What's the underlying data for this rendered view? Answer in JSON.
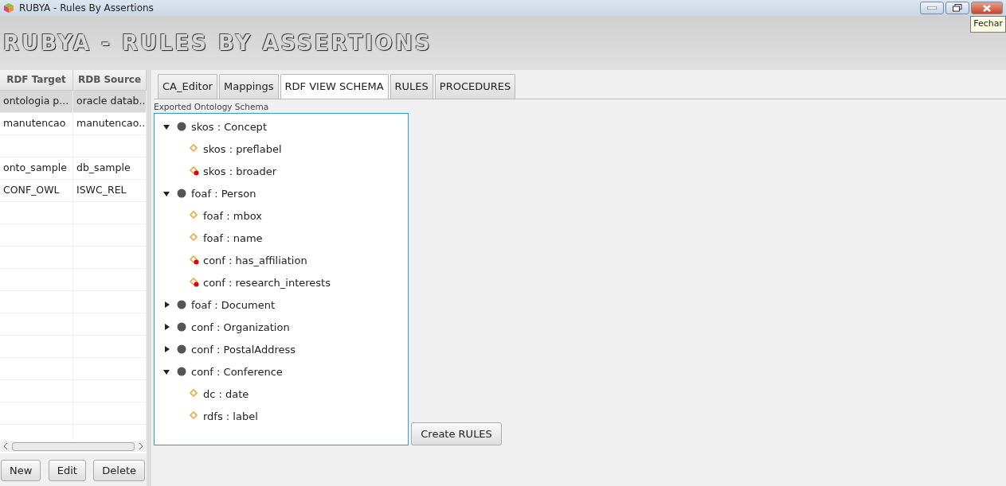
{
  "window": {
    "title": "RUBYA - Rules By Assertions",
    "tooltip": "Fechar"
  },
  "banner": {
    "title": "RUBYA - RULES BY ASSERTIONS"
  },
  "table": {
    "columns": [
      "RDF Target",
      "RDB Source"
    ],
    "rows": [
      {
        "kind": "data",
        "cells": [
          "ontologia p...",
          "oracle datab..."
        ],
        "selected": true
      },
      {
        "kind": "data",
        "cells": [
          "manutencao",
          "manutencao..."
        ],
        "selected": false
      },
      {
        "kind": "blank",
        "selected": false
      },
      {
        "kind": "data",
        "cells": [
          "onto_sample",
          "db_sample"
        ],
        "selected": false
      },
      {
        "kind": "data",
        "cells": [
          "CONF_OWL",
          "ISWC_REL"
        ],
        "selected": false
      }
    ]
  },
  "buttons": [
    "New",
    "Edit",
    "Delete"
  ],
  "tabs": [
    {
      "label": "CA_Editor",
      "selected": false
    },
    {
      "label": "Mappings",
      "selected": false
    },
    {
      "label": "RDF VIEW SCHEMA",
      "selected": true
    },
    {
      "label": "RULES",
      "selected": false
    },
    {
      "label": "PROCEDURES",
      "selected": false
    }
  ],
  "tree": {
    "title": "Exported Ontology Schema",
    "nodes": [
      {
        "kind": "class",
        "label": "skos : Concept",
        "expanded": true,
        "children": [
          {
            "kind": "datatype",
            "label": "skos : preflabel"
          },
          {
            "kind": "object",
            "label": "skos : broader"
          }
        ]
      },
      {
        "kind": "class",
        "label": "foaf : Person",
        "expanded": true,
        "children": [
          {
            "kind": "datatype",
            "label": "foaf : mbox"
          },
          {
            "kind": "datatype",
            "label": "foaf : name"
          },
          {
            "kind": "object",
            "label": "conf : has_affiliation"
          },
          {
            "kind": "object",
            "label": "conf : research_interests"
          }
        ]
      },
      {
        "kind": "class",
        "label": "foaf : Document",
        "expanded": false
      },
      {
        "kind": "class",
        "label": "conf : Organization",
        "expanded": false
      },
      {
        "kind": "class",
        "label": "conf : PostalAddress",
        "expanded": false
      },
      {
        "kind": "class",
        "label": "conf : Conference",
        "expanded": true,
        "children": [
          {
            "kind": "datatype",
            "label": "dc : date"
          },
          {
            "kind": "datatype",
            "label": "rdfs : label"
          }
        ]
      }
    ]
  },
  "action_button": "Create RULES"
}
